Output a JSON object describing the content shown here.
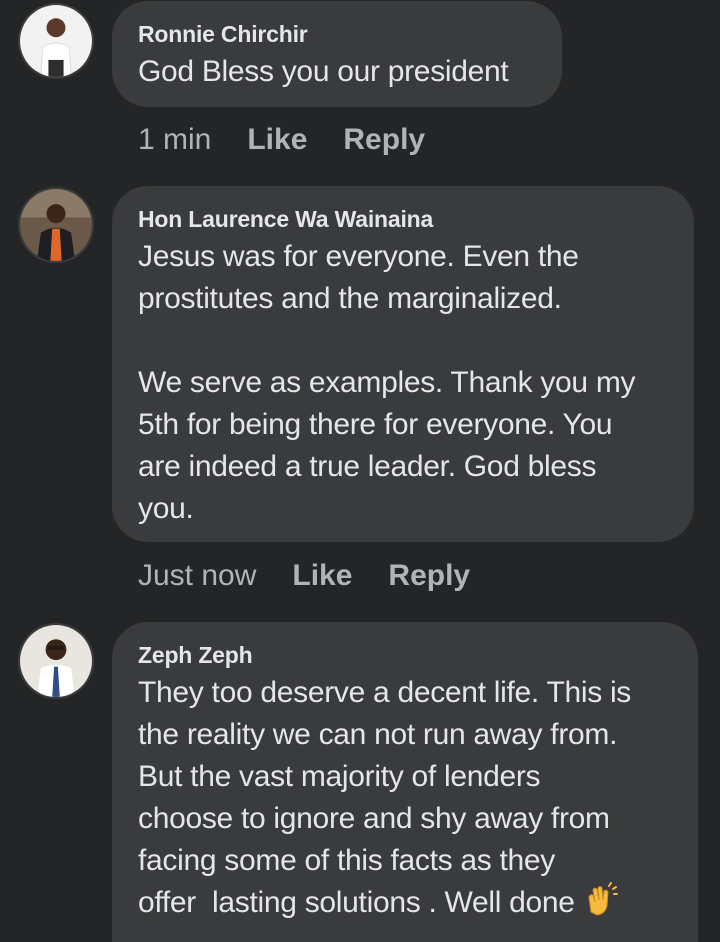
{
  "comments": [
    {
      "author": "Ronnie Chirchir",
      "text": "God Bless you our president",
      "time": "1 min",
      "like_label": "Like",
      "reply_label": "Reply",
      "avatar": "person-white-shirt-avatar"
    },
    {
      "author": "Hon Laurence Wa Wainaina",
      "text": "Jesus was for everyone. Even the\nprostitutes and the marginalized.\n\nWe serve as examples. Thank you my\n5th for being there for everyone. You\nare indeed a true leader. God bless\nyou.",
      "time": "Just now",
      "like_label": "Like",
      "reply_label": "Reply",
      "avatar": "person-dark-jacket-avatar"
    },
    {
      "author": "Zeph Zeph",
      "text": "They too deserve a decent life. This is\nthe reality we can not run away from.\nBut the vast majority of lenders\nchoose to ignore and shy away from\nfacing some of this facts as they\noffer  lasting solutions . Well done",
      "emoji": "clapping-hands-icon",
      "avatar": "person-suit-avatar"
    }
  ],
  "colors": {
    "background": "#242526",
    "bubble": "#3a3b3c",
    "text": "#e4e6eb",
    "secondary": "#b0b3b8"
  }
}
